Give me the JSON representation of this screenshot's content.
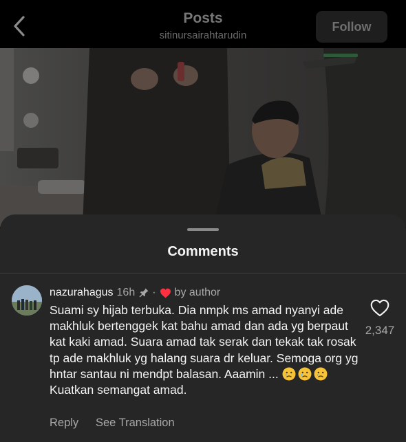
{
  "header": {
    "title": "Posts",
    "username": "sitinursairahtarudin",
    "follow_label": "Follow"
  },
  "post": {
    "image_alt": "Post photo"
  },
  "comments_sheet": {
    "title": "Comments",
    "comment": {
      "username": "nazurahagus",
      "time": "16h",
      "separator": "·",
      "liked_by": "by author",
      "text_main": "Suami sy hijab terbuka. Dia nmpk ms amad nyanyi ade makhluk bertenggek kat bahu amad dan ada yg berpaut kat kaki amad. Suara amad tak serak dan tekak tak rosak tp ade makhluk yg halang suara dr keluar.  Semoga org yg hntar santau ni mendpt balasan. Aaamin ...",
      "text_tail": "Kuatkan semangat amad.",
      "emoji": "crying-face",
      "emoji_count": 3,
      "like_count": "2,347",
      "reply_label": "Reply",
      "translate_label": "See Translation"
    }
  },
  "colors": {
    "background": "#000000",
    "sheet": "#262626",
    "heart": "#ff3040",
    "muted_text": "#a8a8a8"
  },
  "icons": [
    "back-chevron-icon",
    "pin-icon",
    "heart-icon",
    "heart-outline-icon",
    "crying-face-emoji-icon"
  ]
}
